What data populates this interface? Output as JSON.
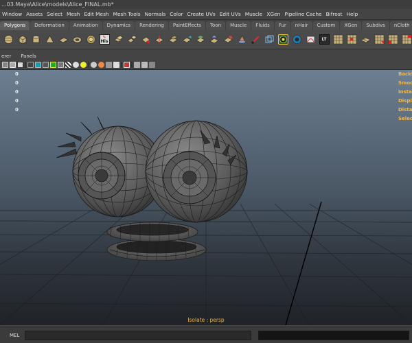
{
  "window": {
    "title": "...03.Maya\\Alice\\models\\Alice_FINAL.mb*"
  },
  "menu": [
    "Window",
    "Assets",
    "Select",
    "Mesh",
    "Edit Mesh",
    "Mesh Tools",
    "Normals",
    "Color",
    "Create UVs",
    "Edit UVs",
    "Muscle",
    "XGen",
    "Pipeline Cache",
    "Bifrost",
    "Help"
  ],
  "shelf_tabs": [
    "Polygons",
    "Deformation",
    "Animation",
    "Dynamics",
    "Rendering",
    "PaintEffects",
    "Toon",
    "Muscle",
    "Fluids",
    "Fur",
    "nHair",
    "Custom",
    "XGen",
    "Subdivs",
    "nCloth"
  ],
  "active_shelf_tab": "Polygons",
  "shelf_labels": {
    "his": "His",
    "lt": "LT",
    "de": "DE"
  },
  "panel_menu": [
    "erer",
    "Panels"
  ],
  "hud": {
    "values": [
      "0",
      "0",
      "0",
      "0",
      "0"
    ],
    "labels": [
      "Backf",
      "Smoo",
      "Instan",
      "Displ",
      "Distan",
      "Selec"
    ]
  },
  "viewport": {
    "isolate_label": "Isolate : persp"
  },
  "command_line": {
    "language": "MEL"
  },
  "colors": {
    "accent_orange": "#f0b44c",
    "viewport_top": "#6c7e91",
    "viewport_bottom": "#1f2328",
    "panel_bg": "#444444"
  }
}
